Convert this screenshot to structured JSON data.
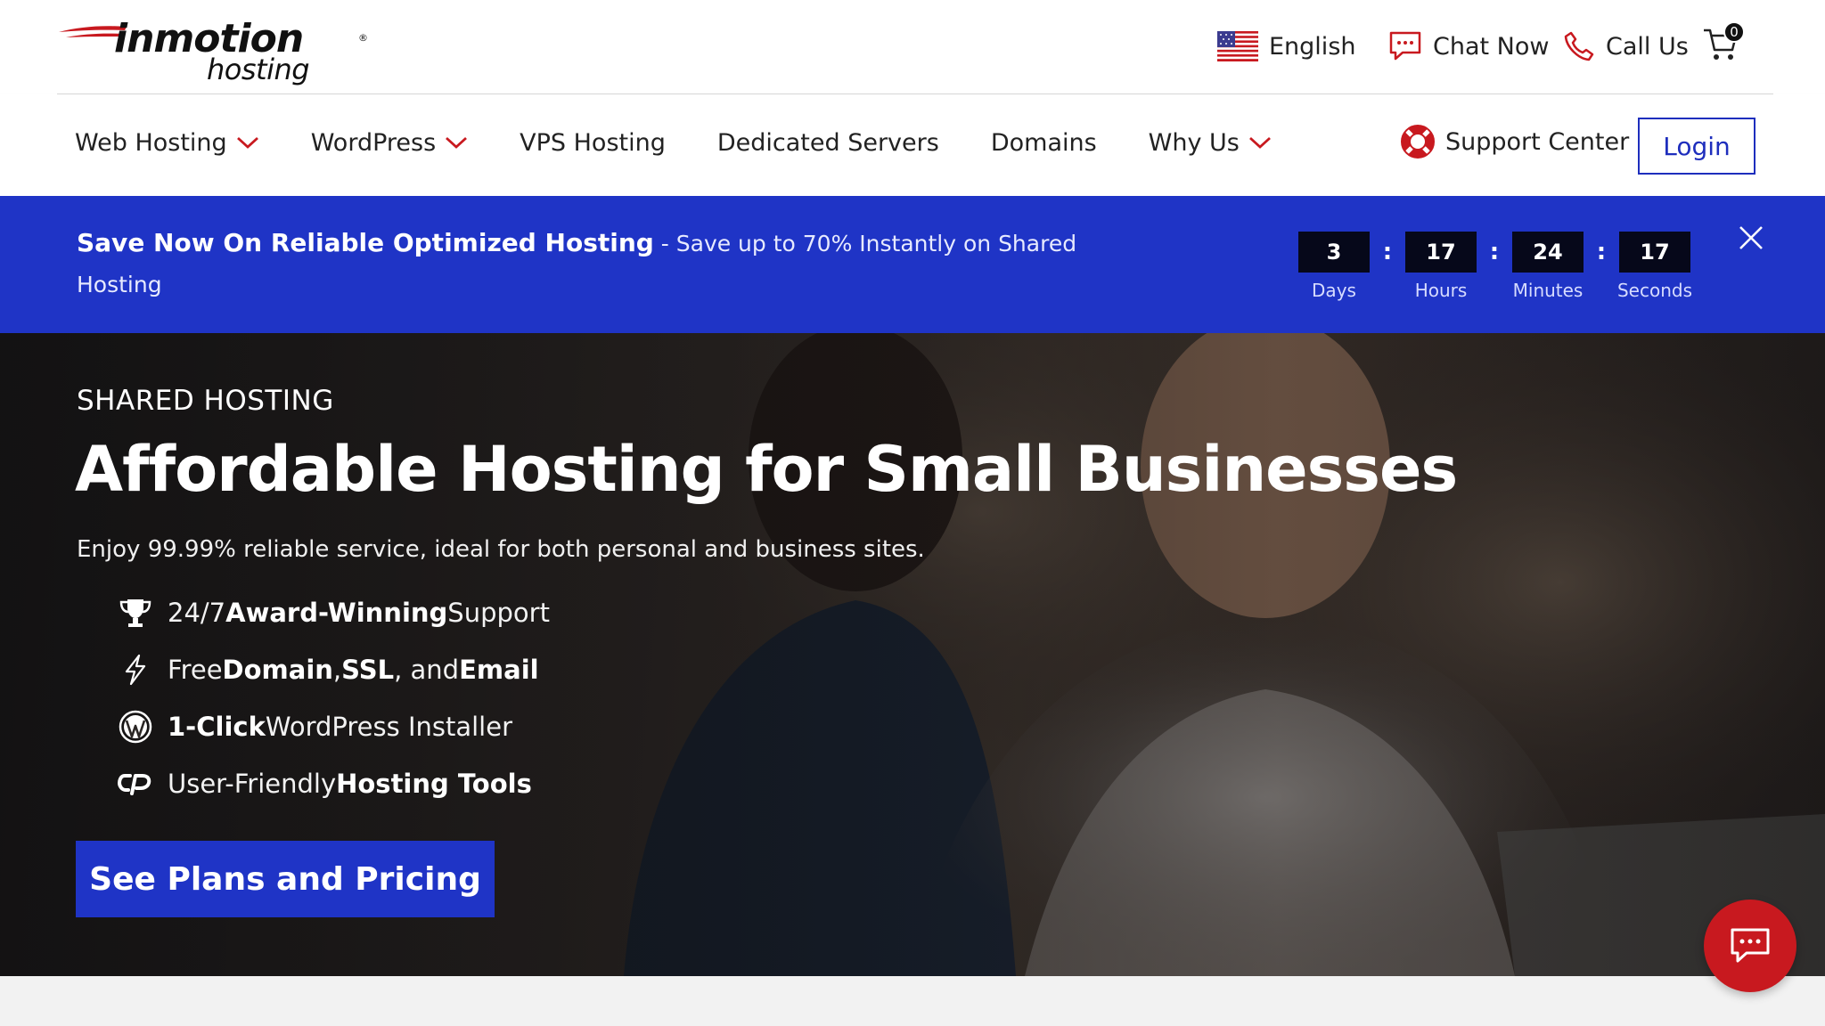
{
  "brand": {
    "name": "inmotion",
    "sub": "hosting",
    "reg": "®",
    "accent_red": "#c8191f",
    "accent_blue": "#1f34c6"
  },
  "utility": {
    "language": "English",
    "chat": "Chat Now",
    "call": "Call Us",
    "cart_count": "0"
  },
  "nav": {
    "items": [
      {
        "label": "Web Hosting",
        "has_dropdown": true
      },
      {
        "label": "WordPress",
        "has_dropdown": true
      },
      {
        "label": "VPS Hosting",
        "has_dropdown": false
      },
      {
        "label": "Dedicated Servers",
        "has_dropdown": false
      },
      {
        "label": "Domains",
        "has_dropdown": false
      },
      {
        "label": "Why Us",
        "has_dropdown": true
      }
    ],
    "support": "Support Center",
    "login": "Login"
  },
  "promo": {
    "headline": "Save Now On Reliable Optimized Hosting",
    "separator": " - ",
    "detail": "Save up to 70% Instantly on Shared Hosting",
    "countdown": {
      "days": {
        "value": "3",
        "label": "Days"
      },
      "hours": {
        "value": "17",
        "label": "Hours"
      },
      "minutes": {
        "value": "24",
        "label": "Minutes"
      },
      "seconds": {
        "value": "17",
        "label": "Seconds"
      },
      "separator": ":"
    }
  },
  "hero": {
    "eyebrow": "SHARED HOSTING",
    "title": "Affordable Hosting for Small Businesses",
    "subtitle": "Enjoy 99.99% reliable service, ideal for both personal and business sites.",
    "features": [
      {
        "icon": "trophy-icon",
        "pre": "24/7 ",
        "bold": "Award-Winning",
        "post": " Support"
      },
      {
        "icon": "lightning-icon",
        "pre": "Free ",
        "bold": "Domain",
        "mid1": ", ",
        "bold2": "SSL",
        "mid2": ", and ",
        "bold3": "Email"
      },
      {
        "icon": "wordpress-icon",
        "pre": "",
        "bold": "1-Click",
        "post": " WordPress Installer"
      },
      {
        "icon": "cpanel-icon",
        "pre": "User-Friendly ",
        "bold": "Hosting Tools",
        "post": ""
      }
    ],
    "cta": "See Plans and Pricing"
  }
}
